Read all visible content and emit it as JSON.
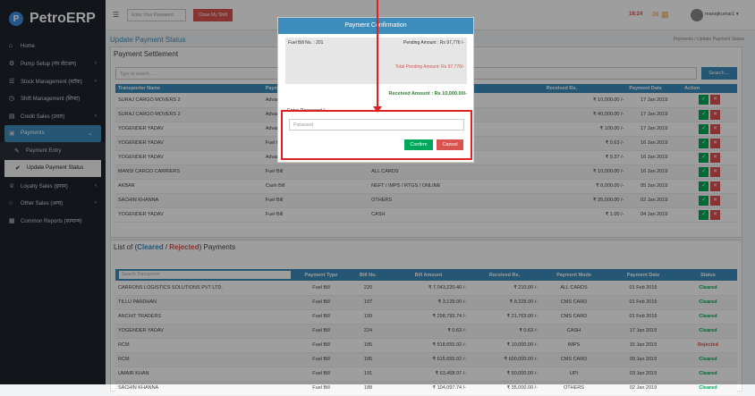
{
  "app": {
    "name": "PetroERP",
    "logo": "P"
  },
  "sidebar": {
    "items": [
      {
        "label": "Home",
        "icon": "⌂"
      },
      {
        "label": "Pump Setup (पंप सेटअप)",
        "icon": "⚙"
      },
      {
        "label": "Stock Management (स्टॉक)",
        "icon": "☰"
      },
      {
        "label": "Shift Management (शिफ्ट)",
        "icon": "◷"
      },
      {
        "label": "Credit Sales (उधार)",
        "icon": "▤"
      },
      {
        "label": "Payments",
        "icon": "▣"
      },
      {
        "label": "Payment Entry",
        "icon": "✎"
      },
      {
        "label": "Update Payment Status",
        "icon": "✔"
      },
      {
        "label": "Loyalty Sales (इनाम)",
        "icon": "♕"
      },
      {
        "label": "Other Sales (अन्य)",
        "icon": "○"
      },
      {
        "label": "Common Reports (सामान्य)",
        "icon": "▦"
      }
    ]
  },
  "topbar": {
    "search_placeholder": "Enter Your Password",
    "shift_button": "Close My Shift",
    "time": "18:24",
    "user": "manojkumar1 ▾"
  },
  "page": {
    "title": "Update Payment Status",
    "breadcrumb": "Payments / Update Payment Status"
  },
  "settlement": {
    "title": "Payment Settlement",
    "search_placeholder": "Type to search.....",
    "search_button": "Search....",
    "columns": [
      "Transporter Name",
      "Payment",
      "",
      "",
      "",
      "Received Rs.",
      "Payment Date",
      "Action"
    ],
    "rows": [
      [
        "SURAJ CARGO MOVERS 2",
        "Advance",
        "",
        "",
        "",
        "₹ 10,000.00 /-",
        "17 Jan 2019"
      ],
      [
        "SURAJ CARGO MOVERS 2",
        "Advance",
        "",
        "",
        "",
        "₹ 40,000.00 /-",
        "17 Jan 2019"
      ],
      [
        "YOGENDER YADAV",
        "Advance",
        "",
        "",
        "",
        "₹ 100.00 /-",
        "17 Jan 2019"
      ],
      [
        "YOGENDER YADAV",
        "Fuel Bill",
        "",
        "",
        "",
        "₹ 0.63 /-",
        "16 Jan 2019"
      ],
      [
        "YOGENDER YADAV",
        "Advance",
        "",
        "",
        "",
        "₹ 9.37 /-",
        "16 Jan 2019"
      ],
      [
        "MANSI CARGO CARRIERS",
        "Fuel Bill",
        "",
        "ALL CARDS",
        "",
        "₹ 10,000.00 /-",
        "16 Jan 2019"
      ],
      [
        "AKBAR",
        "Cash Bill",
        "",
        "NEFT / IMPS / RTGS / ONLINE",
        "",
        "₹ 8,000.00 /-",
        "05 Jan 2019"
      ],
      [
        "SACHIN KHANNA",
        "Fuel Bill",
        "",
        "OTHERS",
        "",
        "₹ 35,000.00 /-",
        "02 Jan 2019"
      ],
      [
        "YOGENDER YADAV",
        "Fuel Bill",
        "",
        "CASH",
        "",
        "₹ 1.00 /-",
        "04 Jan 2019"
      ]
    ]
  },
  "cleared": {
    "title_prefix": "List of (",
    "cleared": "Cleared",
    "sep": " / ",
    "rejected": "Rejected",
    "title_suffix": ") Payments",
    "search_placeholder": "Search Transporter",
    "columns": [
      "",
      "Payment Type",
      "Bill No.",
      "Bill Amount",
      "Received Rs.",
      "Payment Mode",
      "Payment Date",
      "Status"
    ],
    "rows": [
      [
        "CARRONS LOGISTICS SOLUTIONS PVT LTD.",
        "Fuel Bill",
        "220",
        "₹ 7,043,220.40 /-",
        "₹ 210.00 /-",
        "ALL CARDS",
        "01 Feb 2019",
        "Cleared"
      ],
      [
        "TILLU PARDHAN",
        "Fuel Bill",
        "197",
        "₹ 3,129.00 /-",
        "₹ 8,228.00 /-",
        "CMS CARD",
        "01 Feb 2019",
        "Cleared"
      ],
      [
        "ANCHIT TRADERS",
        "Fuel Bill",
        "199",
        "₹ 298,793.74 /-",
        "₹ 21,763.00 /-",
        "CMS CARD",
        "01 Feb 2019",
        "Cleared"
      ],
      [
        "YOGENDER YADAV",
        "Fuel Bill",
        "224",
        "₹ 0.63 /-",
        "₹ 0.63 /-",
        "CASH",
        "17 Jan 2019",
        "Cleared"
      ],
      [
        "RCM",
        "Fuel Bill",
        "185",
        "₹ 618,655.02 /-",
        "₹ 10,000.00 /-",
        "IMPS",
        "15 Jan 2019",
        "Rejected"
      ],
      [
        "RCM",
        "Fuel Bill",
        "185",
        "₹ 615,655.02 /-",
        "₹ 600,000.00 /-",
        "CMS CARD",
        "09 Jan 2019",
        "Cleared"
      ],
      [
        "UMAIR KHAN",
        "Fuel Bill",
        "191",
        "₹ 63,468.07 /-",
        "₹ 50,000.00 /-",
        "UPI",
        "03 Jan 2019",
        "Cleared"
      ],
      [
        "SACHIN KHANNA",
        "Fuel Bill",
        "188",
        "₹ 104,097.74 /-",
        "₹ 35,000.00 /-",
        "OTHERS",
        "02 Jan 2019",
        "Cleared"
      ]
    ]
  },
  "modal": {
    "title": "Payment Confirmation",
    "bill": "Fuel Bill No. : 201",
    "pending": "Pending Amount : Rs 97,776 /-",
    "total_pending": "Total Pending Amount: Rs 97,776/-",
    "received": "Received Amount : Rs 10,000.00/-",
    "password_label": "Enter Password",
    "required": "*",
    "password_placeholder": "Password",
    "confirm": "Confirm",
    "cancel": "Cancel"
  }
}
